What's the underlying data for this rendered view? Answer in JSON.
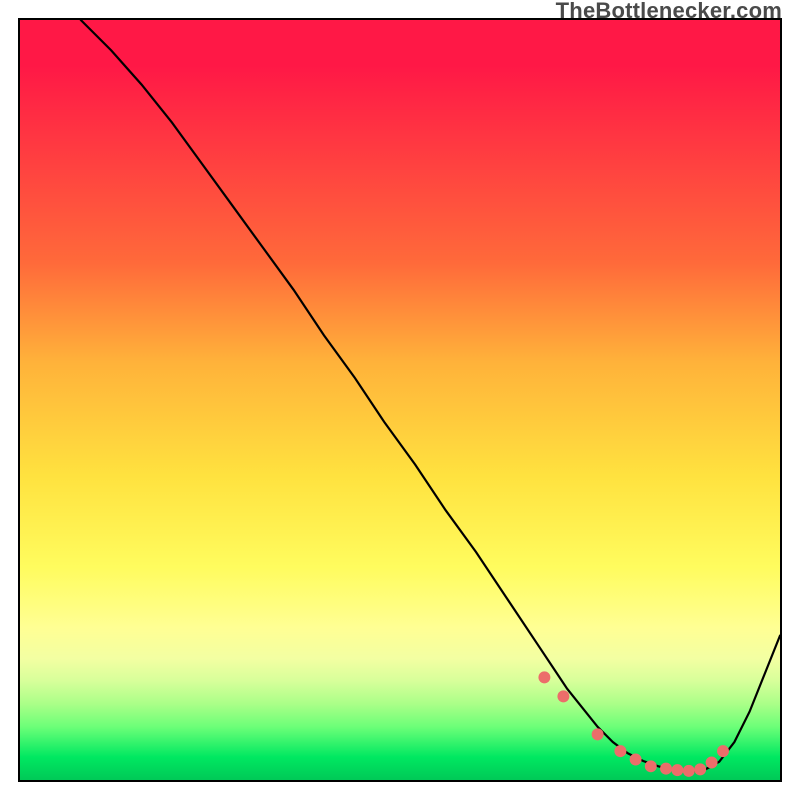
{
  "chart_data": {
    "type": "line",
    "title": "",
    "xlabel": "",
    "ylabel": "",
    "xlim": [
      0,
      100
    ],
    "ylim": [
      0,
      100
    ],
    "series": [
      {
        "name": "curve",
        "x": [
          8,
          12,
          16,
          20,
          24,
          28,
          32,
          36,
          40,
          44,
          48,
          52,
          56,
          60,
          64,
          68,
          70,
          72,
          74,
          76,
          78,
          80,
          82,
          84,
          86,
          88,
          90,
          92,
          94,
          96,
          98,
          100
        ],
        "y": [
          100,
          96,
          91.5,
          86.5,
          81,
          75.5,
          70,
          64.5,
          58.5,
          53,
          47,
          41.5,
          35.5,
          30,
          24,
          18,
          15,
          12,
          9.5,
          7,
          5,
          3.5,
          2.5,
          1.8,
          1.3,
          1.1,
          1.3,
          2.4,
          5,
          9,
          14,
          19
        ]
      }
    ],
    "markers": {
      "name": "dots",
      "x": [
        69,
        71.5,
        76,
        79,
        81,
        83,
        85,
        86.5,
        88,
        89.5,
        91,
        92.5
      ],
      "y": [
        13.5,
        11,
        6,
        3.8,
        2.7,
        1.8,
        1.5,
        1.3,
        1.2,
        1.4,
        2.3,
        3.8
      ]
    },
    "watermark": "TheBottlenecker.com",
    "background_gradient": {
      "top": "#ff1846",
      "mid": "#ffe23f",
      "bottom": "#00c957"
    }
  }
}
